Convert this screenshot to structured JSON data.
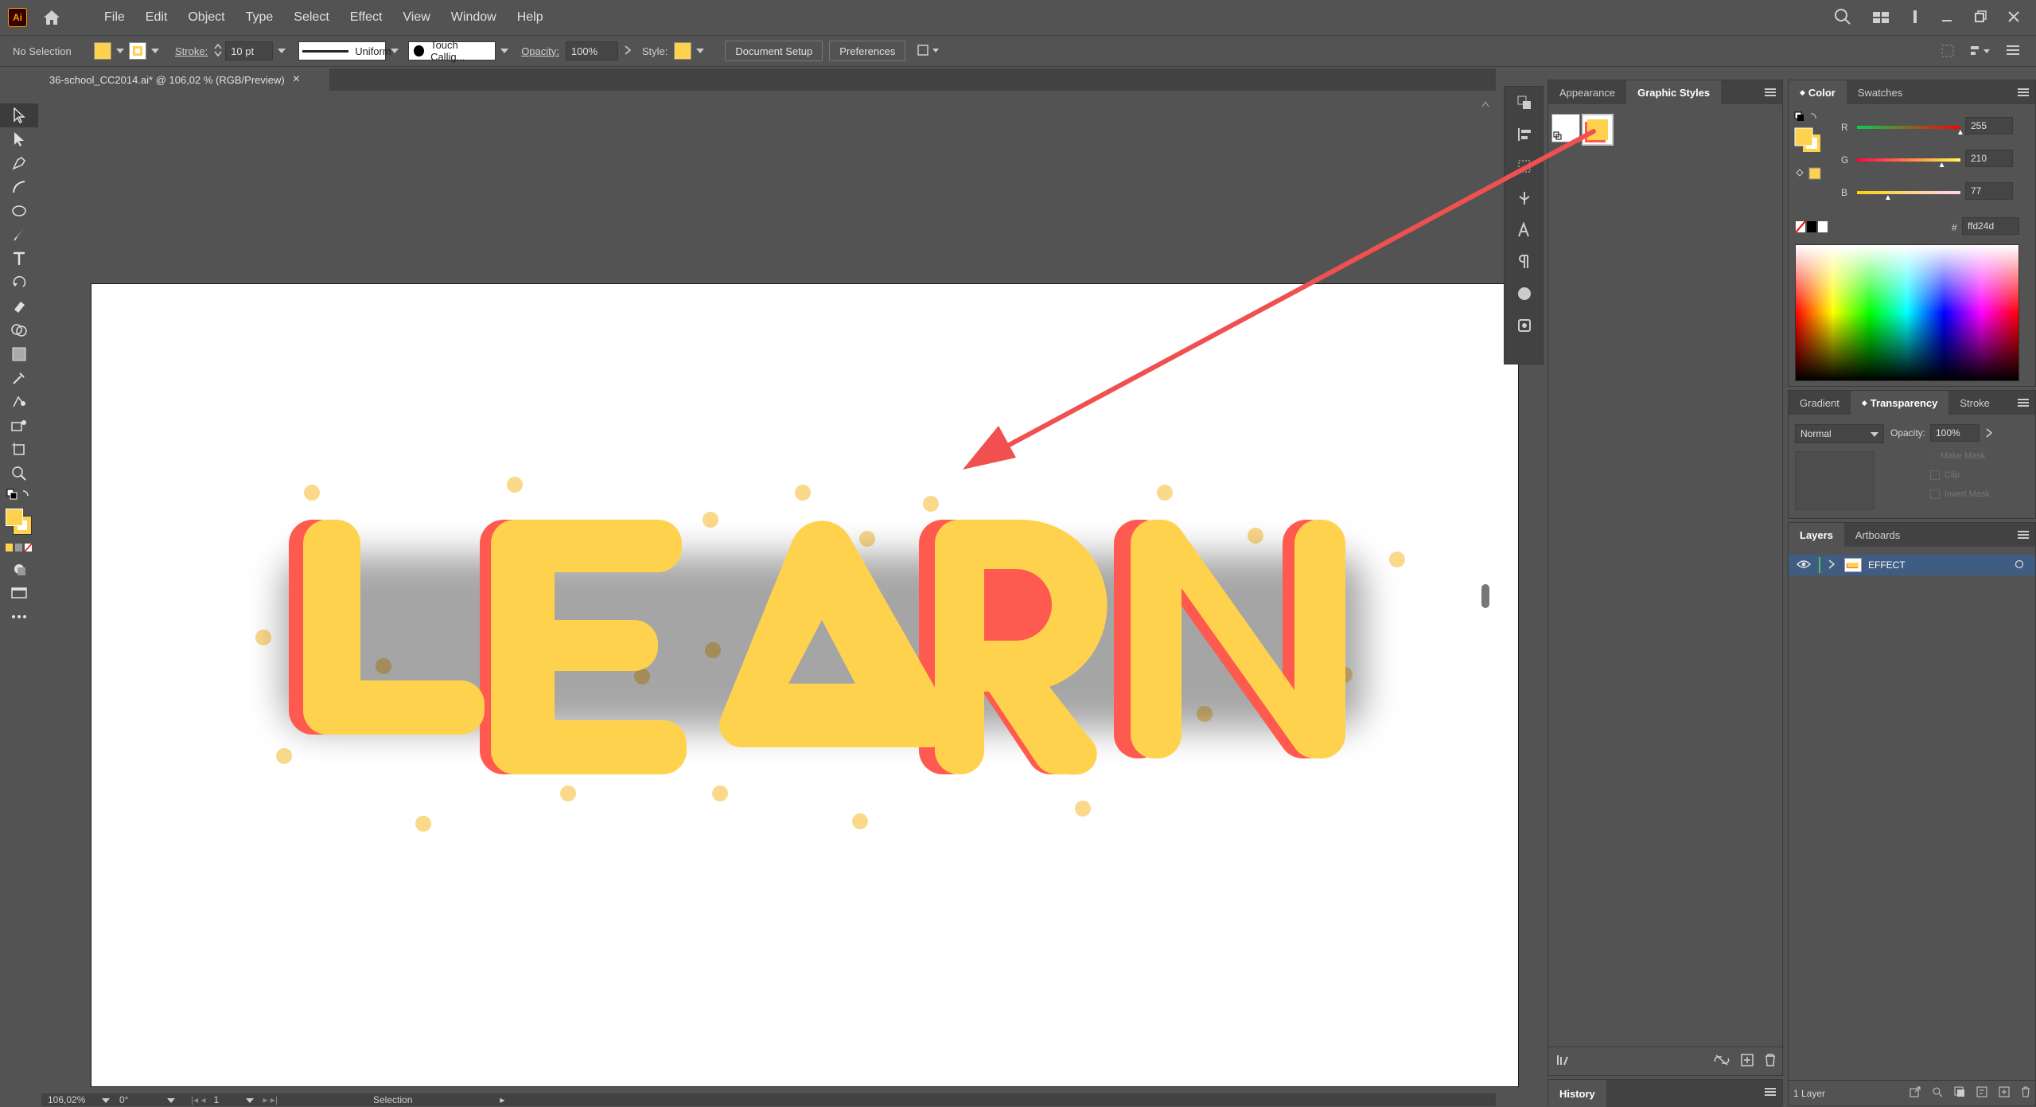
{
  "app": {
    "logo": "Ai"
  },
  "menu": [
    "File",
    "Edit",
    "Object",
    "Type",
    "Select",
    "Effect",
    "View",
    "Window",
    "Help"
  ],
  "control_bar": {
    "selection_label": "No Selection",
    "stroke_label": "Stroke:",
    "stroke_weight": "10 pt",
    "stroke_profile": "Uniform",
    "brush": "Touch Callig...",
    "opacity_label": "Opacity:",
    "opacity_value": "100%",
    "style_label": "Style:",
    "document_setup": "Document Setup",
    "preferences": "Preferences"
  },
  "document_tab": {
    "title": "36-school_CC2014.ai* @ 106,02 % (RGB/Preview)",
    "close": "×"
  },
  "artwork": {
    "text": "LEARN"
  },
  "status_bar": {
    "zoom": "106,02%",
    "rotation": "0°",
    "artboard": "1",
    "tool": "Selection"
  },
  "panels": {
    "appearance_tab": "Appearance",
    "graphic_styles_tab": "Graphic Styles",
    "color_tab": "Color",
    "swatches_tab": "Swatches",
    "r_label": "R",
    "g_label": "G",
    "b_label": "B",
    "r_value": "255",
    "g_value": "210",
    "b_value": "77",
    "r_fraction": 1.0,
    "g_fraction": 0.82,
    "b_fraction": 0.3,
    "hex_label": "#",
    "hex_value": "ffd24d",
    "gradient_tab": "Gradient",
    "transparency_tab": "Transparency",
    "stroke_tab": "Stroke",
    "blend_mode": "Normal",
    "opacity_label": "Opacity:",
    "opacity_value": "100%",
    "make_mask": "Make Mask",
    "clip": "Clip",
    "invert_mask": "Invert Mask",
    "layers_tab": "Layers",
    "artboards_tab": "Artboards",
    "layer_name": "EFFECT",
    "layer_count": "1 Layer",
    "history_tab": "History"
  },
  "colors": {
    "fill": "#ffd24d",
    "shadow": "#ff5a4f",
    "arrow": "#f05050",
    "layer_color": "#4ec94e",
    "dot": "#f9d277"
  }
}
